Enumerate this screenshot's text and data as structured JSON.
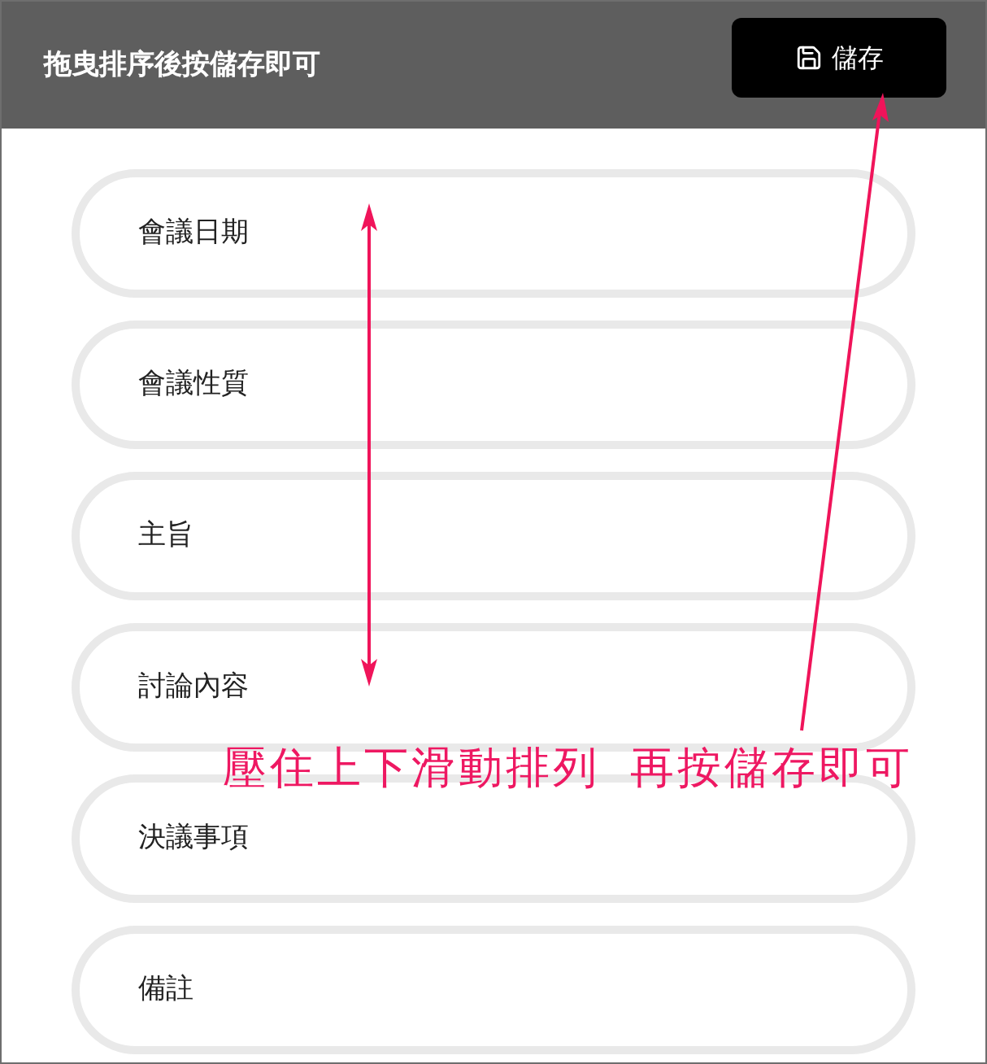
{
  "header": {
    "title": "拖曳排序後按儲存即可",
    "save_button": {
      "label": "儲存"
    }
  },
  "items": [
    {
      "label": "會議日期"
    },
    {
      "label": "會議性質"
    },
    {
      "label": "主旨"
    },
    {
      "label": "討論內容"
    },
    {
      "label": "決議事項"
    },
    {
      "label": "備註"
    }
  ],
  "annotation": {
    "text": "壓住上下滑動排列 再按儲存即可"
  }
}
